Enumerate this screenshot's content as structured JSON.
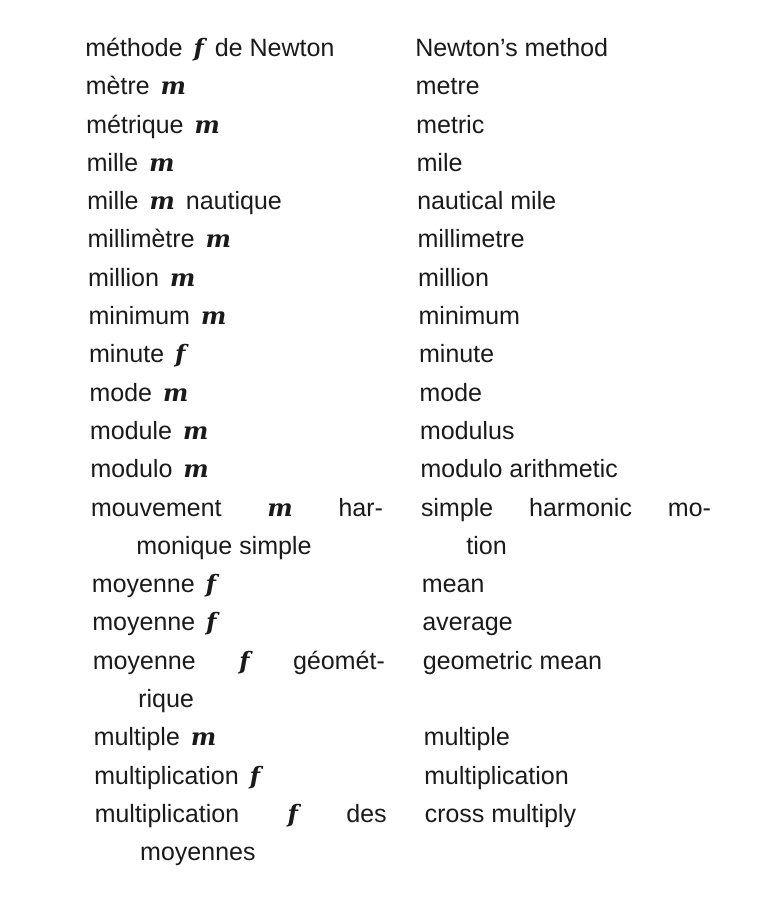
{
  "entries": [
    {
      "fr": {
        "term": "méthode",
        "gender": "f",
        "after": "de Newton"
      },
      "en": {
        "text": "Newton’s method"
      }
    },
    {
      "fr": {
        "term": "mètre",
        "gender": "m",
        "after": ""
      },
      "en": {
        "text": "metre"
      }
    },
    {
      "fr": {
        "term": "métrique",
        "gender": "m",
        "after": ""
      },
      "en": {
        "text": "metric"
      }
    },
    {
      "fr": {
        "term": "mille",
        "gender": "m",
        "after": ""
      },
      "en": {
        "text": "mile"
      }
    },
    {
      "fr": {
        "term": "mille",
        "gender": "m",
        "after": "nautique"
      },
      "en": {
        "text": "nautical mile"
      }
    },
    {
      "fr": {
        "term": "millimètre",
        "gender": "m",
        "after": ""
      },
      "en": {
        "text": "millimetre"
      }
    },
    {
      "fr": {
        "term": "million",
        "gender": "m",
        "after": ""
      },
      "en": {
        "text": "million"
      }
    },
    {
      "fr": {
        "term": "minimum",
        "gender": "m",
        "after": ""
      },
      "en": {
        "text": "minimum"
      }
    },
    {
      "fr": {
        "term": "minute",
        "gender": "f",
        "after": ""
      },
      "en": {
        "text": "minute"
      }
    },
    {
      "fr": {
        "term": "mode",
        "gender": "m",
        "after": ""
      },
      "en": {
        "text": "mode"
      }
    },
    {
      "fr": {
        "term": "module",
        "gender": "m",
        "after": ""
      },
      "en": {
        "text": "modulus"
      }
    },
    {
      "fr": {
        "term": "modulo",
        "gender": "m",
        "after": ""
      },
      "en": {
        "text": "modulo arithmetic"
      }
    },
    {
      "fr": {
        "term": "mouvement",
        "gender": "m",
        "after": "har-",
        "cont": "monique simple"
      },
      "en": {
        "text": "simple harmonic mo-",
        "cont": "tion"
      }
    },
    {
      "fr": {
        "term": "moyenne",
        "gender": "f",
        "after": ""
      },
      "en": {
        "text": "mean"
      }
    },
    {
      "fr": {
        "term": "moyenne",
        "gender": "f",
        "after": ""
      },
      "en": {
        "text": "average"
      }
    },
    {
      "fr": {
        "term": "moyenne",
        "gender": "f",
        "after": "géomét-",
        "cont": "rique"
      },
      "en": {
        "text": "geometric mean"
      }
    },
    {
      "fr": {
        "term": "multiple",
        "gender": "m",
        "after": ""
      },
      "en": {
        "text": "multiple"
      }
    },
    {
      "fr": {
        "term": "multiplication",
        "gender": "f",
        "after": ""
      },
      "en": {
        "text": "multiplication"
      }
    },
    {
      "fr": {
        "term": "multiplication",
        "gender": "f",
        "after": "des",
        "cont": "moyennes"
      },
      "en": {
        "text": "cross multiply"
      }
    }
  ]
}
